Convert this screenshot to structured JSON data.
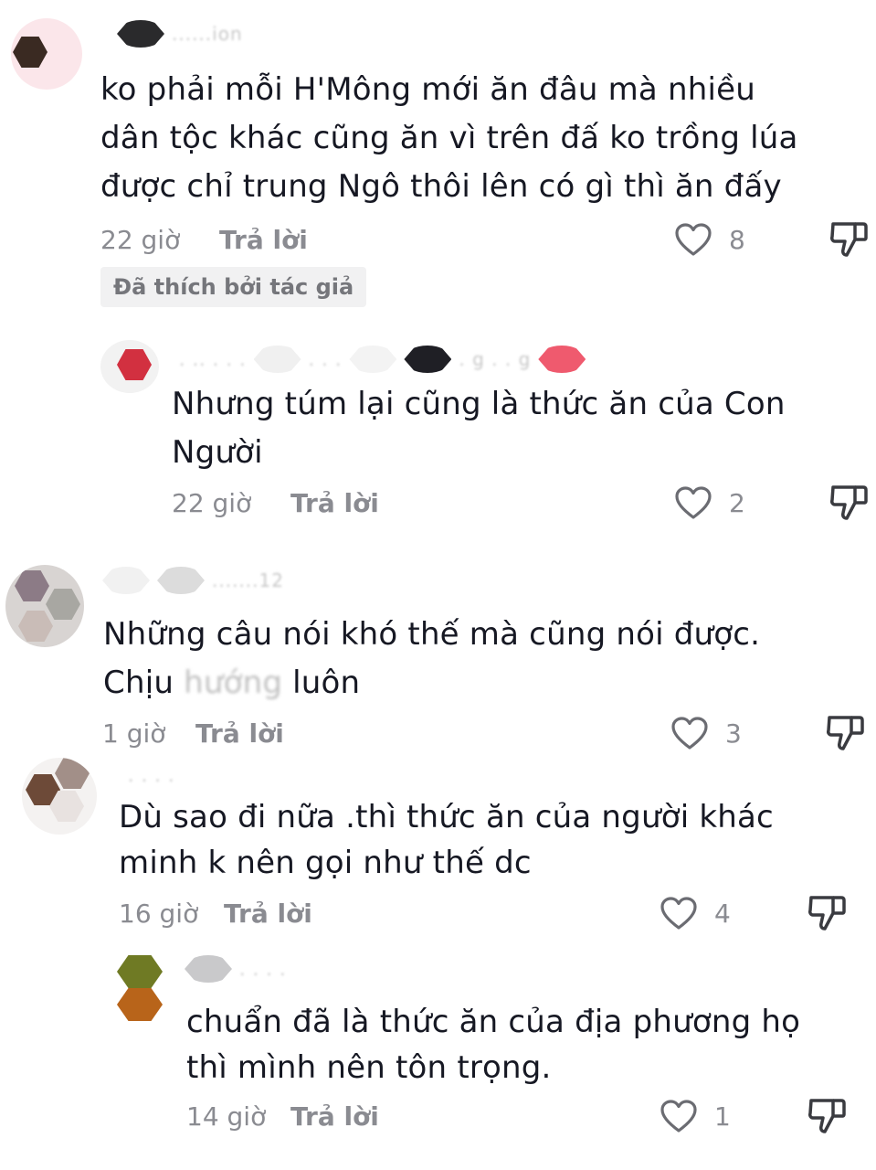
{
  "comments": [
    {
      "text_lines": [
        "ko phải mỗi H'Mông mới ăn đâu mà nhiều",
        "dân tộc khác cũng ăn vì trên đấ ko trồng lúa",
        "được chỉ trung Ngô thôi lên có gì thì ăn đấy"
      ],
      "time": "22 giờ",
      "reply_label": "Trả lời",
      "likes": "8",
      "badge": "Đã thích bởi tác giả"
    },
    {
      "text_lines": [
        "Nhưng túm lại cũng là thức ăn của Con",
        "Người"
      ],
      "time": "22 giờ",
      "reply_label": "Trả lời",
      "likes": "2"
    },
    {
      "text_lines": [
        "Những câu nói khó thế mà cũng nói được."
      ],
      "text_line2_before": "Chịu",
      "text_line2_blurred": "hướng",
      "text_line2_after": " luôn",
      "time": "1 giờ",
      "reply_label": "Trả lời",
      "likes": "3"
    },
    {
      "text_lines": [
        "Dù sao đi nữa .thì thức ăn của người khác",
        "minh k nên gọi như thế dc"
      ],
      "time": "16 giờ",
      "reply_label": "Trả lời",
      "likes": "4"
    },
    {
      "text_lines": [
        "chuẩn đã là thức ăn của địa phương họ",
        "thì mình nên tôn trọng."
      ],
      "time": "14 giờ",
      "reply_label": "Trả lời",
      "likes": "1"
    }
  ],
  "icons": {
    "like": "heart-outline-icon",
    "dislike": "thumbs-down-icon"
  },
  "colors": {
    "text": "#161823",
    "meta": "#8a8b91",
    "badge_bg": "#f1f1f2"
  }
}
